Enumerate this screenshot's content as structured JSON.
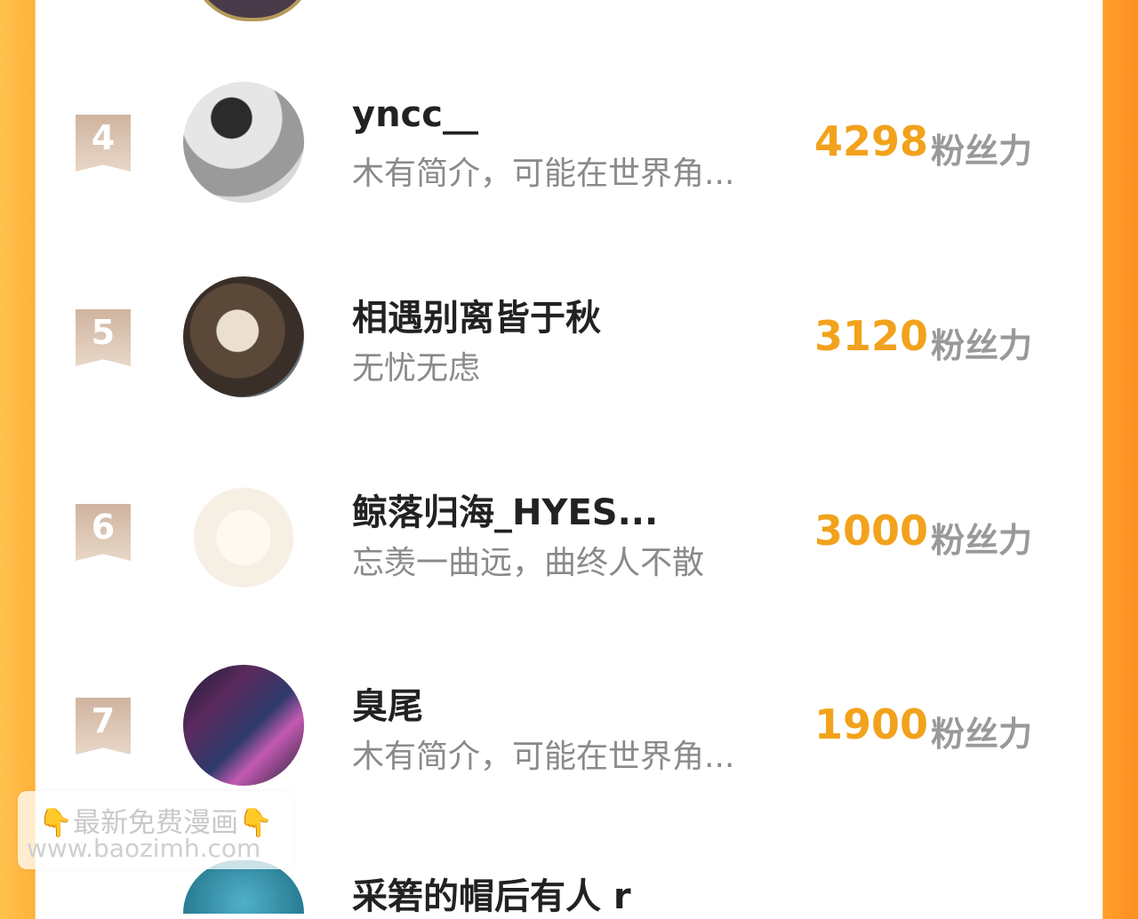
{
  "list": [
    {
      "rank": "4",
      "name": "yncc__",
      "desc": "木有简介，可能在世界角...",
      "score": "4298",
      "unit": "粉丝力",
      "avatar": "portrait-sketch"
    },
    {
      "rank": "5",
      "name": "相遇别离皆于秋",
      "desc": "无忧无虑",
      "score": "3120",
      "unit": "粉丝力",
      "avatar": "anime-portrait"
    },
    {
      "rank": "6",
      "name": "鲸落归海_HYES...",
      "desc": "忘羡一曲远，曲终人不散",
      "score": "3000",
      "unit": "粉丝力",
      "avatar": "rabbit-illustration"
    },
    {
      "rank": "7",
      "name": "臭尾",
      "desc": "木有简介，可能在世界角...",
      "score": "1900",
      "unit": "粉丝力",
      "avatar": "city-neon-photo"
    }
  ],
  "partial_row": {
    "name": "采箬的帽后有人 r"
  },
  "watermark": {
    "line1": "👇最新免费漫画👇",
    "line2": "www.baozimh.com"
  },
  "colors": {
    "score": "#f2a21c",
    "rank_badge": "#cfb49f",
    "frame_left": "#ffb23a",
    "frame_right": "#ff9f2b"
  }
}
